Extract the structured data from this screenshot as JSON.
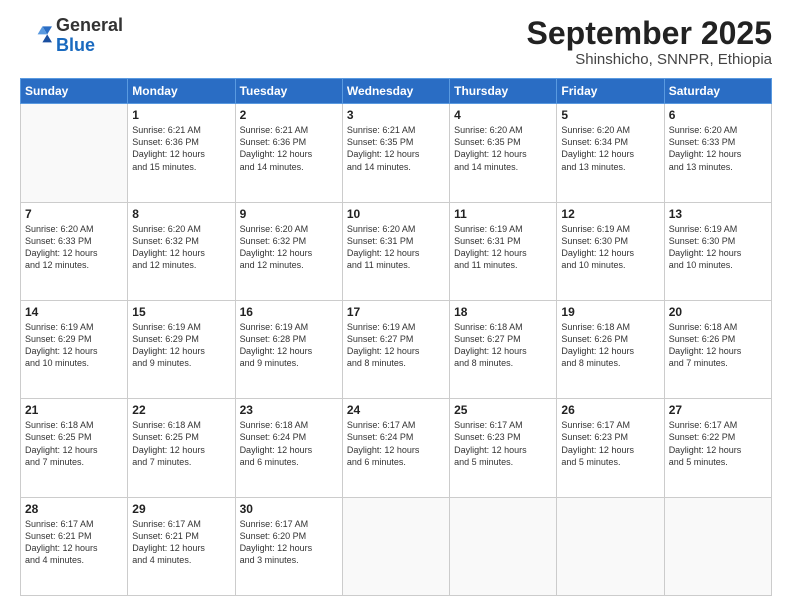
{
  "logo": {
    "general": "General",
    "blue": "Blue"
  },
  "header": {
    "month": "September 2025",
    "location": "Shinshicho, SNNPR, Ethiopia"
  },
  "weekdays": [
    "Sunday",
    "Monday",
    "Tuesday",
    "Wednesday",
    "Thursday",
    "Friday",
    "Saturday"
  ],
  "weeks": [
    [
      {
        "day": "",
        "info": ""
      },
      {
        "day": "1",
        "info": "Sunrise: 6:21 AM\nSunset: 6:36 PM\nDaylight: 12 hours\nand 15 minutes."
      },
      {
        "day": "2",
        "info": "Sunrise: 6:21 AM\nSunset: 6:36 PM\nDaylight: 12 hours\nand 14 minutes."
      },
      {
        "day": "3",
        "info": "Sunrise: 6:21 AM\nSunset: 6:35 PM\nDaylight: 12 hours\nand 14 minutes."
      },
      {
        "day": "4",
        "info": "Sunrise: 6:20 AM\nSunset: 6:35 PM\nDaylight: 12 hours\nand 14 minutes."
      },
      {
        "day": "5",
        "info": "Sunrise: 6:20 AM\nSunset: 6:34 PM\nDaylight: 12 hours\nand 13 minutes."
      },
      {
        "day": "6",
        "info": "Sunrise: 6:20 AM\nSunset: 6:33 PM\nDaylight: 12 hours\nand 13 minutes."
      }
    ],
    [
      {
        "day": "7",
        "info": "Sunrise: 6:20 AM\nSunset: 6:33 PM\nDaylight: 12 hours\nand 12 minutes."
      },
      {
        "day": "8",
        "info": "Sunrise: 6:20 AM\nSunset: 6:32 PM\nDaylight: 12 hours\nand 12 minutes."
      },
      {
        "day": "9",
        "info": "Sunrise: 6:20 AM\nSunset: 6:32 PM\nDaylight: 12 hours\nand 12 minutes."
      },
      {
        "day": "10",
        "info": "Sunrise: 6:20 AM\nSunset: 6:31 PM\nDaylight: 12 hours\nand 11 minutes."
      },
      {
        "day": "11",
        "info": "Sunrise: 6:19 AM\nSunset: 6:31 PM\nDaylight: 12 hours\nand 11 minutes."
      },
      {
        "day": "12",
        "info": "Sunrise: 6:19 AM\nSunset: 6:30 PM\nDaylight: 12 hours\nand 10 minutes."
      },
      {
        "day": "13",
        "info": "Sunrise: 6:19 AM\nSunset: 6:30 PM\nDaylight: 12 hours\nand 10 minutes."
      }
    ],
    [
      {
        "day": "14",
        "info": "Sunrise: 6:19 AM\nSunset: 6:29 PM\nDaylight: 12 hours\nand 10 minutes."
      },
      {
        "day": "15",
        "info": "Sunrise: 6:19 AM\nSunset: 6:29 PM\nDaylight: 12 hours\nand 9 minutes."
      },
      {
        "day": "16",
        "info": "Sunrise: 6:19 AM\nSunset: 6:28 PM\nDaylight: 12 hours\nand 9 minutes."
      },
      {
        "day": "17",
        "info": "Sunrise: 6:19 AM\nSunset: 6:27 PM\nDaylight: 12 hours\nand 8 minutes."
      },
      {
        "day": "18",
        "info": "Sunrise: 6:18 AM\nSunset: 6:27 PM\nDaylight: 12 hours\nand 8 minutes."
      },
      {
        "day": "19",
        "info": "Sunrise: 6:18 AM\nSunset: 6:26 PM\nDaylight: 12 hours\nand 8 minutes."
      },
      {
        "day": "20",
        "info": "Sunrise: 6:18 AM\nSunset: 6:26 PM\nDaylight: 12 hours\nand 7 minutes."
      }
    ],
    [
      {
        "day": "21",
        "info": "Sunrise: 6:18 AM\nSunset: 6:25 PM\nDaylight: 12 hours\nand 7 minutes."
      },
      {
        "day": "22",
        "info": "Sunrise: 6:18 AM\nSunset: 6:25 PM\nDaylight: 12 hours\nand 7 minutes."
      },
      {
        "day": "23",
        "info": "Sunrise: 6:18 AM\nSunset: 6:24 PM\nDaylight: 12 hours\nand 6 minutes."
      },
      {
        "day": "24",
        "info": "Sunrise: 6:17 AM\nSunset: 6:24 PM\nDaylight: 12 hours\nand 6 minutes."
      },
      {
        "day": "25",
        "info": "Sunrise: 6:17 AM\nSunset: 6:23 PM\nDaylight: 12 hours\nand 5 minutes."
      },
      {
        "day": "26",
        "info": "Sunrise: 6:17 AM\nSunset: 6:23 PM\nDaylight: 12 hours\nand 5 minutes."
      },
      {
        "day": "27",
        "info": "Sunrise: 6:17 AM\nSunset: 6:22 PM\nDaylight: 12 hours\nand 5 minutes."
      }
    ],
    [
      {
        "day": "28",
        "info": "Sunrise: 6:17 AM\nSunset: 6:21 PM\nDaylight: 12 hours\nand 4 minutes."
      },
      {
        "day": "29",
        "info": "Sunrise: 6:17 AM\nSunset: 6:21 PM\nDaylight: 12 hours\nand 4 minutes."
      },
      {
        "day": "30",
        "info": "Sunrise: 6:17 AM\nSunset: 6:20 PM\nDaylight: 12 hours\nand 3 minutes."
      },
      {
        "day": "",
        "info": ""
      },
      {
        "day": "",
        "info": ""
      },
      {
        "day": "",
        "info": ""
      },
      {
        "day": "",
        "info": ""
      }
    ]
  ]
}
